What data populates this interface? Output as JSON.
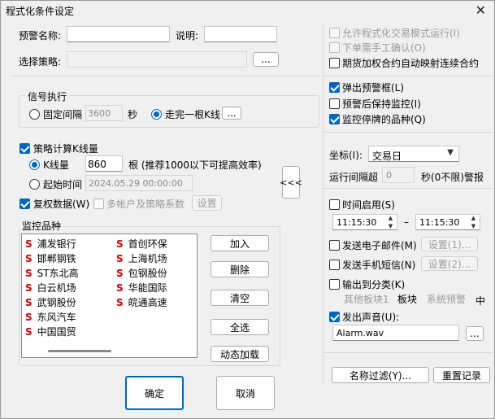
{
  "window": {
    "title": "程式化条件设定",
    "close_glyph": "✕"
  },
  "form": {
    "alert_name_label": "预警名称:",
    "alert_name_value": "",
    "desc_label": "说明:",
    "desc_value": "",
    "strategy_label": "选择策略:",
    "strategy_value": "",
    "browse_label": "..."
  },
  "signal": {
    "group_title": "信号执行",
    "fixed_label": "固定间隔",
    "fixed_value": "3600",
    "sec_label": "秒",
    "kline_label": "走完一根K线",
    "kline_btn": "..."
  },
  "strategy_calc": {
    "label": "策略计算K线量",
    "kcount_label": "K线量",
    "kcount_value": "860",
    "kcount_hint": "根 (推荐1000以下可提高效率)",
    "start_label": "起始时间",
    "start_value": "2024.05.29 00:00:00",
    "rights_label": "复权数据(W)",
    "multi_label": "多帐户及策略系数",
    "settings_label": "设置"
  },
  "watch": {
    "group_title": "监控品种",
    "col1": [
      "浦发银行",
      "邯郸钢铁",
      "ST东北高",
      "白云机场",
      "武钢股份",
      "东风汽车",
      "中国国贸"
    ],
    "col2": [
      "首创环保",
      "上海机场",
      "包钢股份",
      "华能国际",
      "皖通高速"
    ],
    "mark": "S",
    "add": "加入",
    "delete": "删除",
    "clear": "清空",
    "select_all": "全选",
    "dynamic_load": "动态加载"
  },
  "collapse_label": "<<<",
  "footer": {
    "ok": "确定",
    "cancel": "取消"
  },
  "right": {
    "allow_auto": "允许程式化交易模式运行(I)",
    "manual_confirm": "下单需手工确认(O)",
    "futures_map": "期货加权合约自动映射连续合约",
    "popup": "弹出预警框(L)",
    "keep_monitor": "预警后保持监控(I)",
    "monitor_suspend": "监控停牌的品种(Q)",
    "axis_label": "坐标(I):",
    "axis_value": "交易日",
    "run_interval_label": "运行间隔超",
    "run_interval_value": "0",
    "run_interval_hint": "秒(0不限)警报",
    "time_enable": "时间启用(S)",
    "time_from": "11:15:30",
    "time_to": "11:15:30",
    "dash": "–",
    "email": "发送电子邮件(M)",
    "email_set": "设置(1)...",
    "sms": "发送手机短信(N)",
    "sms_set": "设置(2)...",
    "output_cat": "输出到分类(K)",
    "cat_other": "其他板块1",
    "cat_block": "板块",
    "cat_sys": "系统预警",
    "cat_mid": "中",
    "sound": "发出声音(U):",
    "sound_file": "Alarm.wav",
    "sound_btn": "...",
    "name_filter": "名称过滤(Y)...",
    "reset": "重置记录"
  }
}
